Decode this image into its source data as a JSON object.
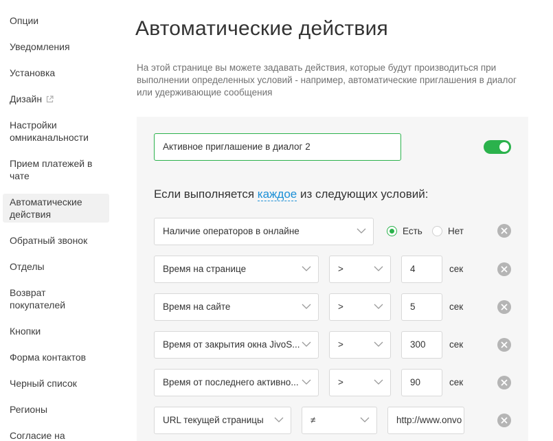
{
  "sidebar": {
    "items": [
      {
        "label": "Опции"
      },
      {
        "label": "Уведомления"
      },
      {
        "label": "Установка"
      },
      {
        "label": "Дизайн",
        "icon": "external-link-icon"
      },
      {
        "label": "Настройки омниканальности"
      },
      {
        "label": "Прием платежей в чате"
      },
      {
        "label": "Автоматические действия",
        "active": true
      },
      {
        "label": "Обратный звонок"
      },
      {
        "label": "Отделы"
      },
      {
        "label": "Возврат покупателей"
      },
      {
        "label": "Кнопки"
      },
      {
        "label": "Форма контактов"
      },
      {
        "label": "Черный список"
      },
      {
        "label": "Регионы"
      },
      {
        "label": "Согласие на"
      }
    ]
  },
  "main": {
    "title": "Автоматические действия",
    "description": "На этой странице вы можете задавать действия, которые будут производиться при выполнении определенных условий - например, автоматические приглашения в диалог или удерживающие сообщения"
  },
  "rule": {
    "name_value": "Активное приглашение в диалог 2",
    "enabled": true,
    "conditions_prefix": "Если выполняется",
    "conditions_link": "каждое",
    "conditions_suffix": "из следующих условий:",
    "conditions": [
      {
        "field": "Наличие операторов в онлайне",
        "radio_yes": "Есть",
        "radio_no": "Нет",
        "selected": "Есть"
      },
      {
        "field": "Время на странице",
        "operator": ">",
        "value": "4",
        "unit": "сек"
      },
      {
        "field": "Время на сайте",
        "operator": ">",
        "value": "5",
        "unit": "сек"
      },
      {
        "field": "Время от закрытия окна JivoS...",
        "operator": ">",
        "value": "300",
        "unit": "сек"
      },
      {
        "field": "Время от последнего активно...",
        "operator": ">",
        "value": "90",
        "unit": "сек"
      },
      {
        "field": "URL текущей страницы",
        "operator": "≠",
        "value": "http://www.onvo"
      }
    ]
  },
  "colors": {
    "accent": "#2bb24c",
    "link": "#1b8fd6",
    "panel": "#f6f6f6"
  }
}
